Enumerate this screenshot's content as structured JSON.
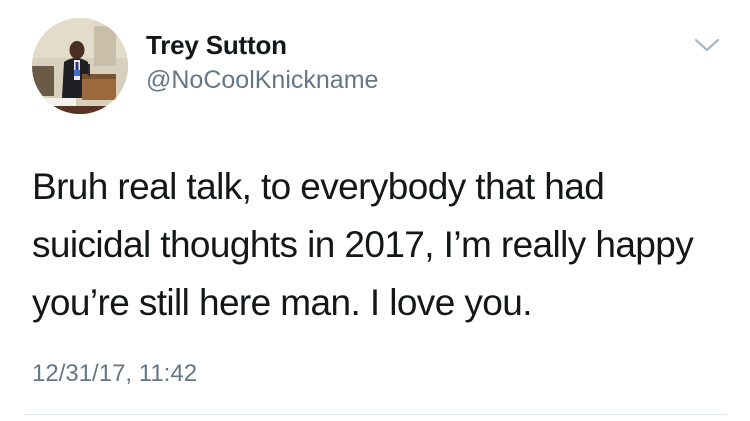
{
  "tweet": {
    "author": {
      "display_name": "Trey Sutton",
      "handle": "@NoCoolKnickname",
      "avatar_icon": "profile-photo"
    },
    "text": "Bruh real talk, to everybody that had suicidal thoughts in 2017, I’m really happy you’re still here man. I love you.",
    "timestamp": "12/31/17, 11:42",
    "menu_icon": "chevron-down-icon"
  },
  "colors": {
    "primary_text": "#14171a",
    "secondary_text": "#657786",
    "divider": "#e1e8ed",
    "chevron": "#aab8c2"
  }
}
